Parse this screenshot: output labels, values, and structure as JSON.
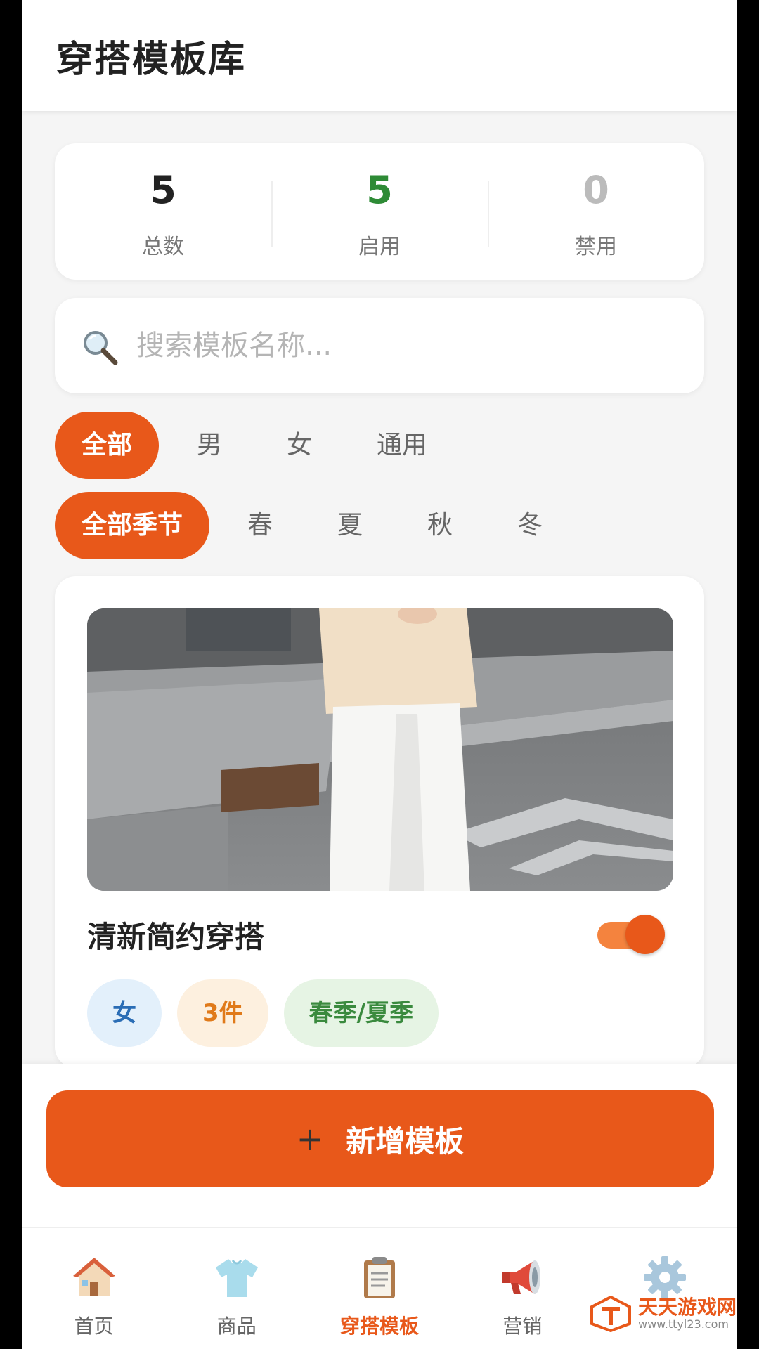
{
  "header": {
    "title": "穿搭模板库"
  },
  "stats": [
    {
      "value": "5",
      "label": "总数",
      "color": "#222222"
    },
    {
      "value": "5",
      "label": "启用",
      "color": "#2e8b36"
    },
    {
      "value": "0",
      "label": "禁用",
      "color": "#bbbbbb"
    }
  ],
  "search": {
    "icon": "magnifier-icon",
    "placeholder": "搜索模板名称..."
  },
  "gender_filters": [
    "全部",
    "男",
    "女",
    "通用"
  ],
  "gender_selected": "全部",
  "season_filters": [
    "全部季节",
    "春",
    "夏",
    "秋",
    "冬"
  ],
  "season_selected": "全部季节",
  "template_card": {
    "title": "清新简约穿搭",
    "enabled": true,
    "tags": [
      {
        "text": "女",
        "bg": "#e3f0fb",
        "color": "#2a6db5"
      },
      {
        "text": "3件",
        "bg": "#fdf0df",
        "color": "#e07a1a"
      },
      {
        "text": "春季/夏季",
        "bg": "#e6f4e4",
        "color": "#3a8a3e"
      }
    ]
  },
  "add_button": {
    "plus": "+",
    "label": "新增模板"
  },
  "tabbar": [
    {
      "icon": "house-icon",
      "label": "首页",
      "active": false
    },
    {
      "icon": "tshirt-icon",
      "label": "商品",
      "active": false
    },
    {
      "icon": "clipboard-icon",
      "label": "穿搭模板",
      "active": true
    },
    {
      "icon": "megaphone-icon",
      "label": "营销",
      "active": false
    },
    {
      "icon": "gear-icon",
      "label": "",
      "active": false
    }
  ],
  "watermark": {
    "name": "天天游戏网",
    "url": "www.ttyl23.com"
  },
  "colors": {
    "accent": "#e8581a",
    "background": "#f5f5f5"
  }
}
